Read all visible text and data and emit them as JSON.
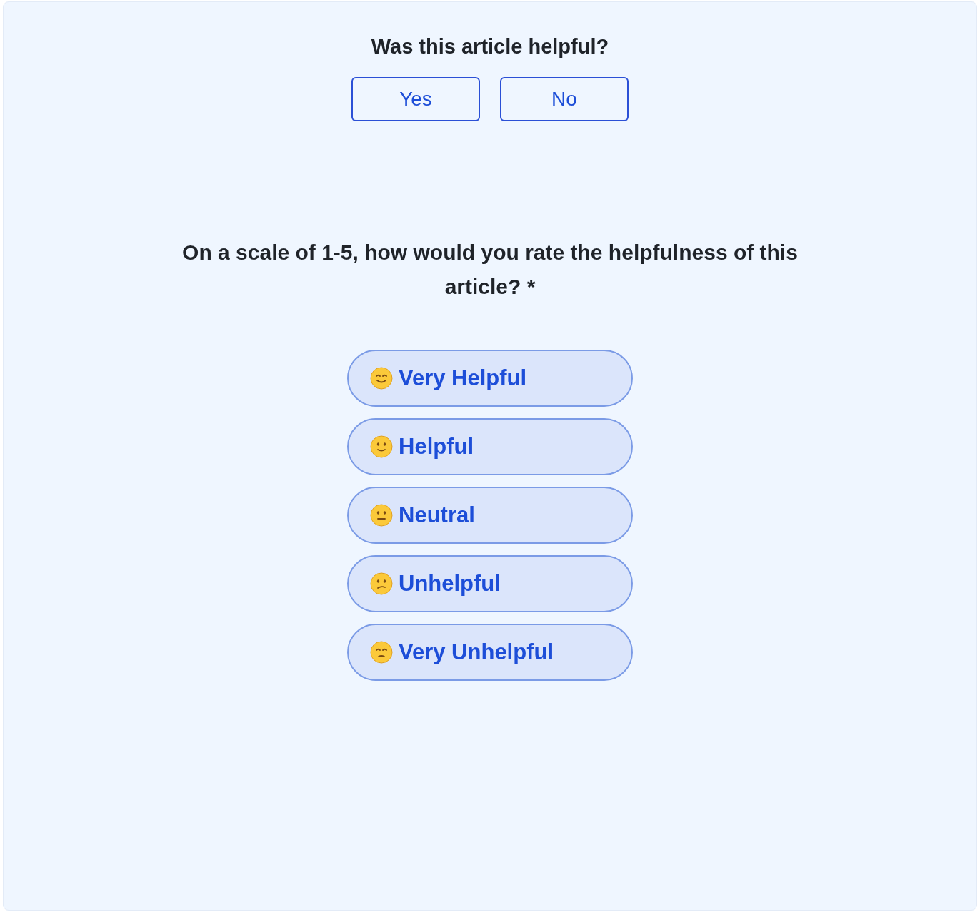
{
  "feedback": {
    "question": "Was this article helpful?",
    "buttons": [
      "Yes",
      "No"
    ]
  },
  "rating": {
    "question": "On a scale of 1-5, how would you rate the helpfulness of this article? *",
    "options": [
      {
        "label": "Very Helpful"
      },
      {
        "label": "Helpful"
      },
      {
        "label": "Neutral"
      },
      {
        "label": "Unhelpful"
      },
      {
        "label": "Very Unhelpful"
      }
    ]
  }
}
